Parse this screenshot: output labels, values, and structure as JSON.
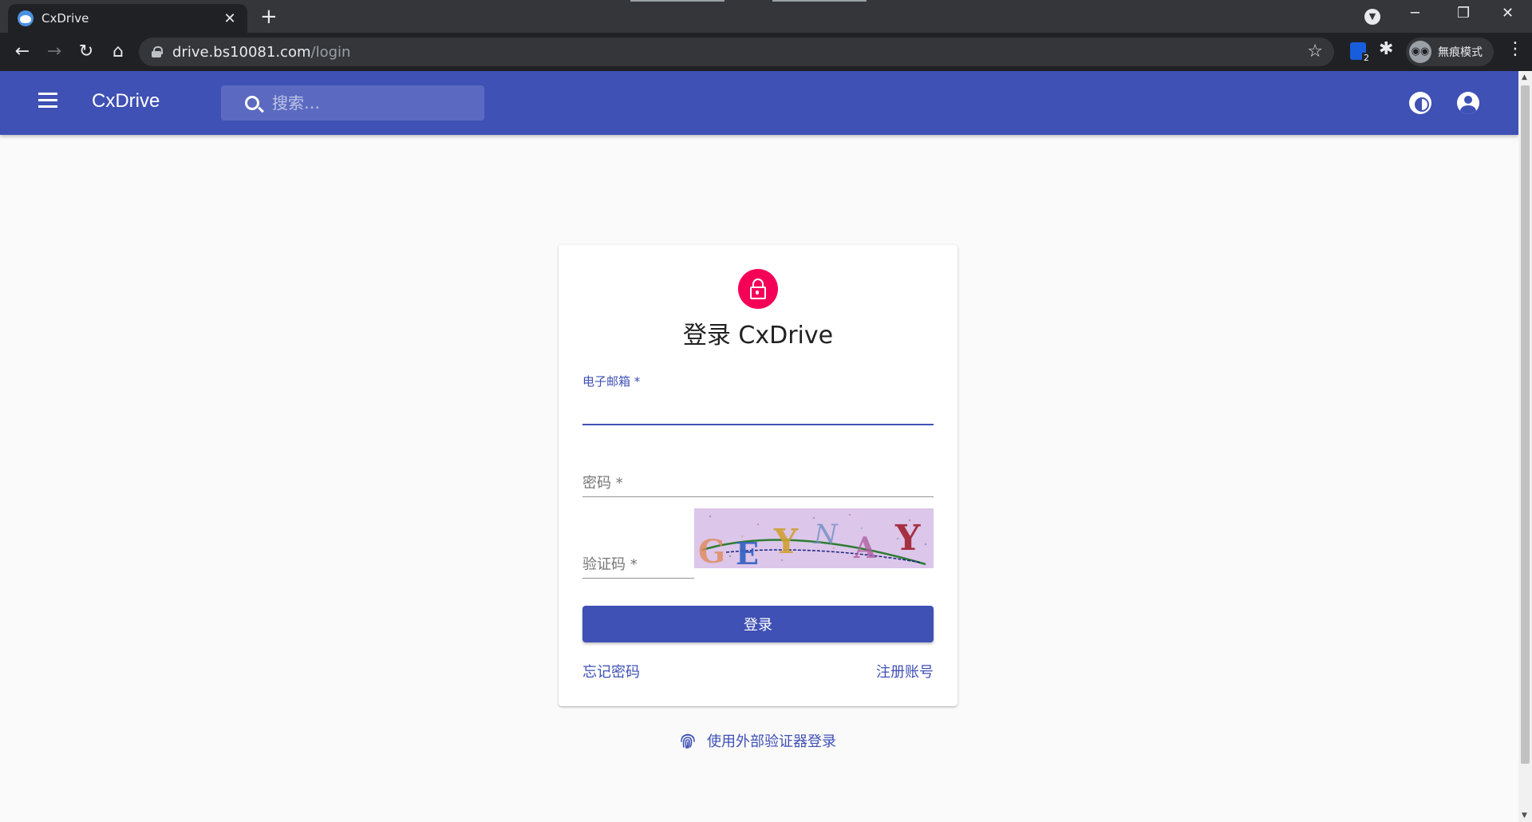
{
  "browser": {
    "tab_title": "CxDrive",
    "tab_close": "✕",
    "new_tab": "+",
    "url_host": "drive.bs10081.com",
    "url_path": "/login",
    "incognito_label": "無痕模式",
    "bitwarden_badge": "2",
    "icons": [
      "back-arrow-icon",
      "forward-arrow-icon",
      "reload-icon",
      "home-icon",
      "lock-icon",
      "star-icon",
      "puzzle-icon",
      "incognito-icon",
      "kebab-menu-icon"
    ]
  },
  "appbar": {
    "title": "CxDrive",
    "search_placeholder": "搜索…",
    "accent_color": "#3f51b5"
  },
  "login": {
    "title": "登录 CxDrive",
    "email_label": "电子邮箱 *",
    "email_value": "",
    "password_label": "密码 *",
    "password_value": "",
    "captcha_label": "验证码 *",
    "captcha_value": "",
    "captcha_text": [
      "G",
      "E",
      "Y",
      "N",
      "A",
      "Y"
    ],
    "submit_label": "登录",
    "forgot_label": "忘记密码",
    "register_label": "注册账号",
    "external_auth_label": "使用外部验证器登录",
    "lock_color": "#f50057"
  }
}
